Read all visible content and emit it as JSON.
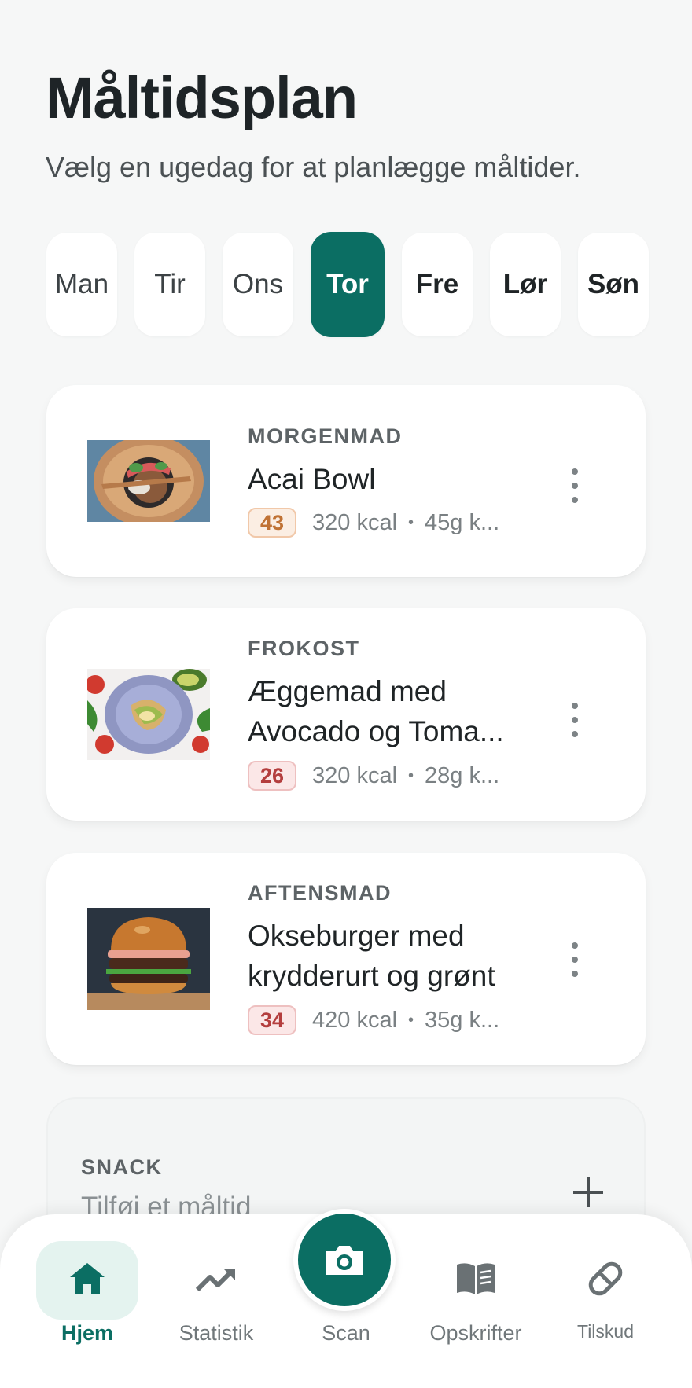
{
  "header": {
    "title": "Måltidsplan",
    "subtitle": "Vælg en ugedag for at planlægge måltider."
  },
  "days": {
    "selected": "Tor",
    "items": [
      "Man",
      "Tir",
      "Ons",
      "Tor",
      "Fre",
      "Lør",
      "Søn"
    ]
  },
  "meals": [
    {
      "type": "MORGENMAD",
      "name": "Acai Bowl",
      "score": "43",
      "score_color": "#c07234",
      "kcal": "320 kcal",
      "macro": "45g k...",
      "image": "acai-bowl-photo"
    },
    {
      "type": "FROKOST",
      "name": "Æggemad med Avocado og Toma...",
      "score": "26",
      "score_color": "#b43e3e",
      "kcal": "320 kcal",
      "macro": "28g k...",
      "image": "egg-sandwich-photo"
    },
    {
      "type": "AFTENSMAD",
      "name": "Okseburger med krydderurt og grønt",
      "score": "34",
      "score_color": "#b43e3e",
      "kcal": "420 kcal",
      "macro": "35g k...",
      "image": "burger-photo"
    }
  ],
  "snack": {
    "type": "SNACK",
    "add_label": "Tilføj et måltid"
  },
  "tabbar": {
    "home": "Hjem",
    "stats": "Statistik",
    "scan": "Scan",
    "recipes": "Opskrifter",
    "supplements": "Tilskud"
  },
  "colors": {
    "accent": "#0b6e63",
    "accent_light": "#e4f3ef",
    "background": "#f6f7f7"
  }
}
